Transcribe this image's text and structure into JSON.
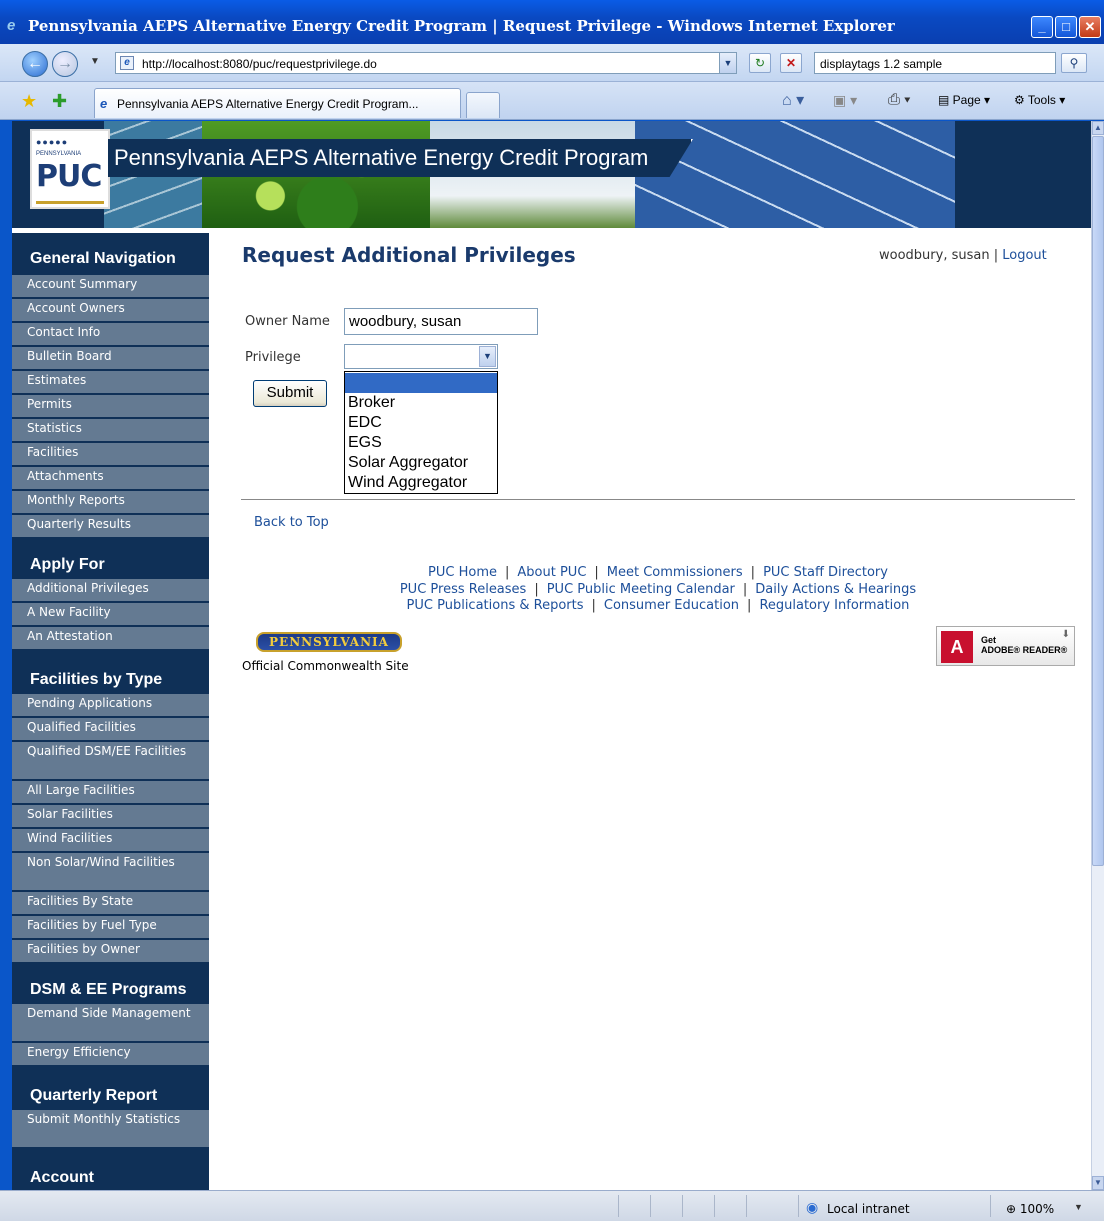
{
  "window": {
    "title": "Pennsylvania AEPS Alternative Energy Credit Program | Request Privilege - Windows Internet Explorer",
    "url": "http://localhost:8080/puc/requestprivilege.do",
    "search_text": "displaytags 1.2 sample",
    "tab_label": "Pennsylvania AEPS Alternative Energy Credit Program...",
    "page_menu": "Page",
    "tools_menu": "Tools"
  },
  "banner": {
    "title": "Pennsylvania AEPS Alternative Energy Credit Program",
    "logo_text": "PUC",
    "logo_state": "PENNSYLVANIA"
  },
  "sidebar": {
    "sections": [
      {
        "heading": "General Navigation",
        "items": [
          "Account Summary",
          "Account Owners",
          "Contact Info",
          "Bulletin Board",
          "Estimates",
          "Permits",
          "Statistics",
          "Facilities",
          "Attachments",
          "Monthly Reports",
          "Quarterly Results"
        ]
      },
      {
        "heading": "Apply For",
        "items": [
          "Additional Privileges",
          "A New Facility",
          "An Attestation"
        ]
      },
      {
        "heading": "Facilities by Type",
        "items": [
          "Pending Applications",
          "Qualified Facilities",
          "Qualified DSM/EE Facilities",
          "All Large Facilities",
          "Solar Facilities",
          "Wind Facilities",
          "Non Solar/Wind Facilities",
          "Facilities By State",
          "Facilities by Fuel Type",
          "Facilities by Owner"
        ]
      },
      {
        "heading": "DSM & EE Programs",
        "items": [
          "Demand Side Management",
          "Energy Efficiency"
        ]
      },
      {
        "heading": "Quarterly Report",
        "items": [
          "Submit Monthly Statistics"
        ]
      },
      {
        "heading": "Account",
        "items": []
      }
    ]
  },
  "main": {
    "title": "Request Additional Privileges",
    "user_name": "woodbury, susan",
    "logout_label": "Logout",
    "owner_label": "Owner Name",
    "owner_value": "woodbury, susan",
    "privilege_label": "Privilege",
    "privilege_options": [
      "",
      "Broker",
      "EDC",
      "EGS",
      "Solar Aggregator",
      "Wind Aggregator"
    ],
    "submit_label": "Submit",
    "back_to_top": "Back to Top"
  },
  "footer": {
    "links_row1": [
      "PUC Home",
      "About PUC",
      "Meet Commissioners",
      "PUC Staff Directory"
    ],
    "links_row2": [
      "PUC Press Releases",
      "PUC Public Meeting Calendar",
      "Daily Actions & Hearings"
    ],
    "links_row3": [
      "PUC Publications & Reports",
      "Consumer Education",
      "Regulatory Information"
    ],
    "pa_logo_word": "PENNSYLVANIA",
    "pa_logo_sub": "Official Commonwealth Site",
    "adobe_get": "Get",
    "adobe_reader": "ADOBE® READER®"
  },
  "statusbar": {
    "zone": "Local intranet",
    "zoom": "100%"
  }
}
